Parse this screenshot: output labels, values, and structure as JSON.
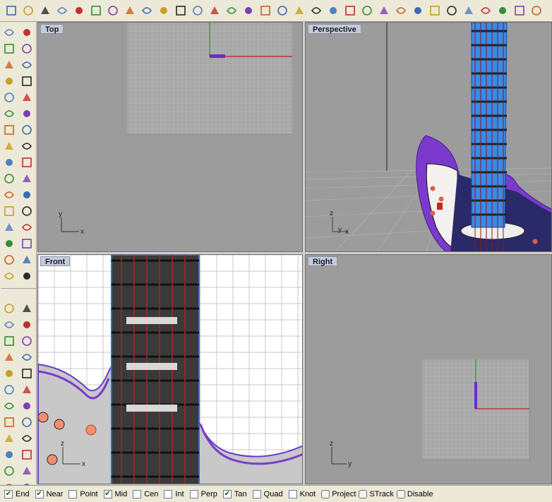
{
  "toolbar": {
    "icons": [
      "new-icon",
      "open-icon",
      "save-icon",
      "print-icon",
      "import-icon",
      "cut-icon",
      "copy-icon",
      "paste-icon",
      "undo-icon",
      "pan-icon",
      "rotate-view-icon",
      "zoom-icon",
      "zoom-window-icon",
      "zoom-extents-icon",
      "zoom-selected-icon",
      "rotate-icon",
      "four-viewports-icon",
      "car-icon",
      "surface-icon",
      "target-icon",
      "select-icon",
      "light-icon",
      "lock-icon",
      "layers-icon",
      "color-wheel-icon",
      "sphere-icon",
      "gear-icon",
      "render-sphere-icon",
      "flag-icon",
      "settings-icon",
      "grid-snap-icon",
      "help-icon"
    ]
  },
  "left_tools": {
    "group1": [
      "select-arrow-icon",
      "point-icon",
      "polyline-icon",
      "curve-icon",
      "circle-icon",
      "arc-icon",
      "ellipse-icon",
      "rectangle-icon",
      "polygon-icon",
      "fillet-icon",
      "circle-surface-icon",
      "offset-icon",
      "surface-patch-icon",
      "loft-icon",
      "box-icon",
      "sphere-solid-icon",
      "cylinder-icon",
      "surface-plane-icon",
      "transform-icon",
      "boolean-icon",
      "move-icon",
      "split-icon",
      "group-icon",
      "array-icon",
      "curve-edit-icon",
      "point-edit-icon",
      "text-icon",
      "dimension-icon",
      "block-icon",
      "properties-icon",
      "render-icon",
      "mesh-icon"
    ],
    "group2": [
      "solid-red-icon",
      "solid-pink-icon",
      "extrude-icon",
      "revolve-icon",
      "sweep-icon",
      "network-icon",
      "blend-icon",
      "fillet-solid-icon",
      "bulb-icon",
      "cap-icon",
      "anchor-icon",
      "shell-icon",
      "tooth-icon",
      "edge-icon",
      "chamfer-icon",
      "cross-icon",
      "wedge-icon",
      "cone-icon",
      "cube-wire-icon",
      "cube-solid-icon",
      "pipe-icon",
      "torus-icon",
      "mesh-box-icon",
      "mesh-surface-icon",
      "shape-icon",
      "layer-cube-icon"
    ]
  },
  "viewports": {
    "top": {
      "title": "Top",
      "axis_x": "x",
      "axis_y": "y"
    },
    "perspective": {
      "title": "Perspective",
      "axis_x": "x",
      "axis_y": "y",
      "axis_z": "z"
    },
    "front": {
      "title": "Front",
      "axis_x": "x",
      "axis_z": "z"
    },
    "right": {
      "title": "Right",
      "axis_y": "y",
      "axis_z": "z"
    }
  },
  "osnap": {
    "items": [
      {
        "label": "End",
        "checked": true
      },
      {
        "label": "Near",
        "checked": true
      },
      {
        "label": "Point",
        "checked": false
      },
      {
        "label": "Mid",
        "checked": true
      },
      {
        "label": "Cen",
        "checked": false
      },
      {
        "label": "Int",
        "checked": false
      },
      {
        "label": "Perp",
        "checked": false
      },
      {
        "label": "Tan",
        "checked": true
      },
      {
        "label": "Quad",
        "checked": false
      },
      {
        "label": "Knot",
        "checked": false
      }
    ],
    "toggles": [
      {
        "label": "Project"
      },
      {
        "label": "STrack"
      },
      {
        "label": "Disable"
      }
    ]
  },
  "colors": {
    "viewport_bg": "#9c9c9c",
    "grid": "#b0b0b0",
    "x_axis": "#c02020",
    "y_axis": "#20a020",
    "guitar_body": "#7a3acb",
    "neck": "#2c6fd8",
    "fret": "#5a1010"
  }
}
